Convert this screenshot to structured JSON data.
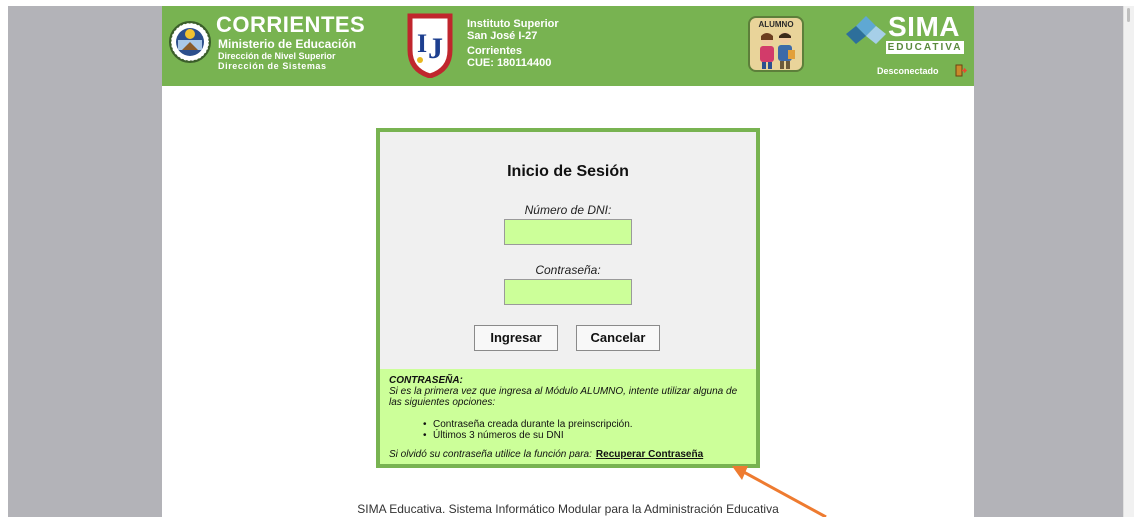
{
  "header": {
    "ministry": {
      "title": "CORRIENTES",
      "line1": "Ministerio de Educación",
      "line2": "Dirección de Nivel Superior",
      "line3": "Dirección de Sistemas"
    },
    "institute": {
      "name_line1": "Instituto Superior",
      "name_line2": "San José I-27",
      "city": "Corrientes",
      "cue": "CUE: 180114400"
    },
    "module_badge": "ALUMNO",
    "brand": {
      "name": "SIMA",
      "tagline": "EDUCATIVA"
    },
    "status": "Desconectado",
    "icons": {
      "ministry_logo": "seal-icon",
      "institute_logo": "ij-shield-icon",
      "module": "students-icon",
      "brand": "diamond-icon",
      "status": "exit-door-icon"
    }
  },
  "login": {
    "title": "Inicio de Sesión",
    "dni_label": "Número de DNI:",
    "dni_value": "",
    "password_label": "Contraseña:",
    "password_value": "",
    "submit_label": "Ingresar",
    "cancel_label": "Cancelar"
  },
  "info": {
    "title": "CONTRASEÑA:",
    "text": "Si es la primera vez que ingresa al Módulo ALUMNO, intente utilizar alguna de las siguientes opciones:",
    "options": [
      "Contraseña creada durante la preinscripción.",
      "Últimos 3 números de su DNI"
    ],
    "footer_prefix": "Si olvidó su contraseña utilice la función para:",
    "recover_link": "Recuperar Contraseña"
  },
  "footer": "SIMA Educativa. Sistema Informático Modular para la Administración Educativa",
  "colors": {
    "header_green": "#78b351",
    "input_green": "#ccff99",
    "annotation_arrow": "#ee7b30",
    "side_gray": "#b3b3b8"
  }
}
